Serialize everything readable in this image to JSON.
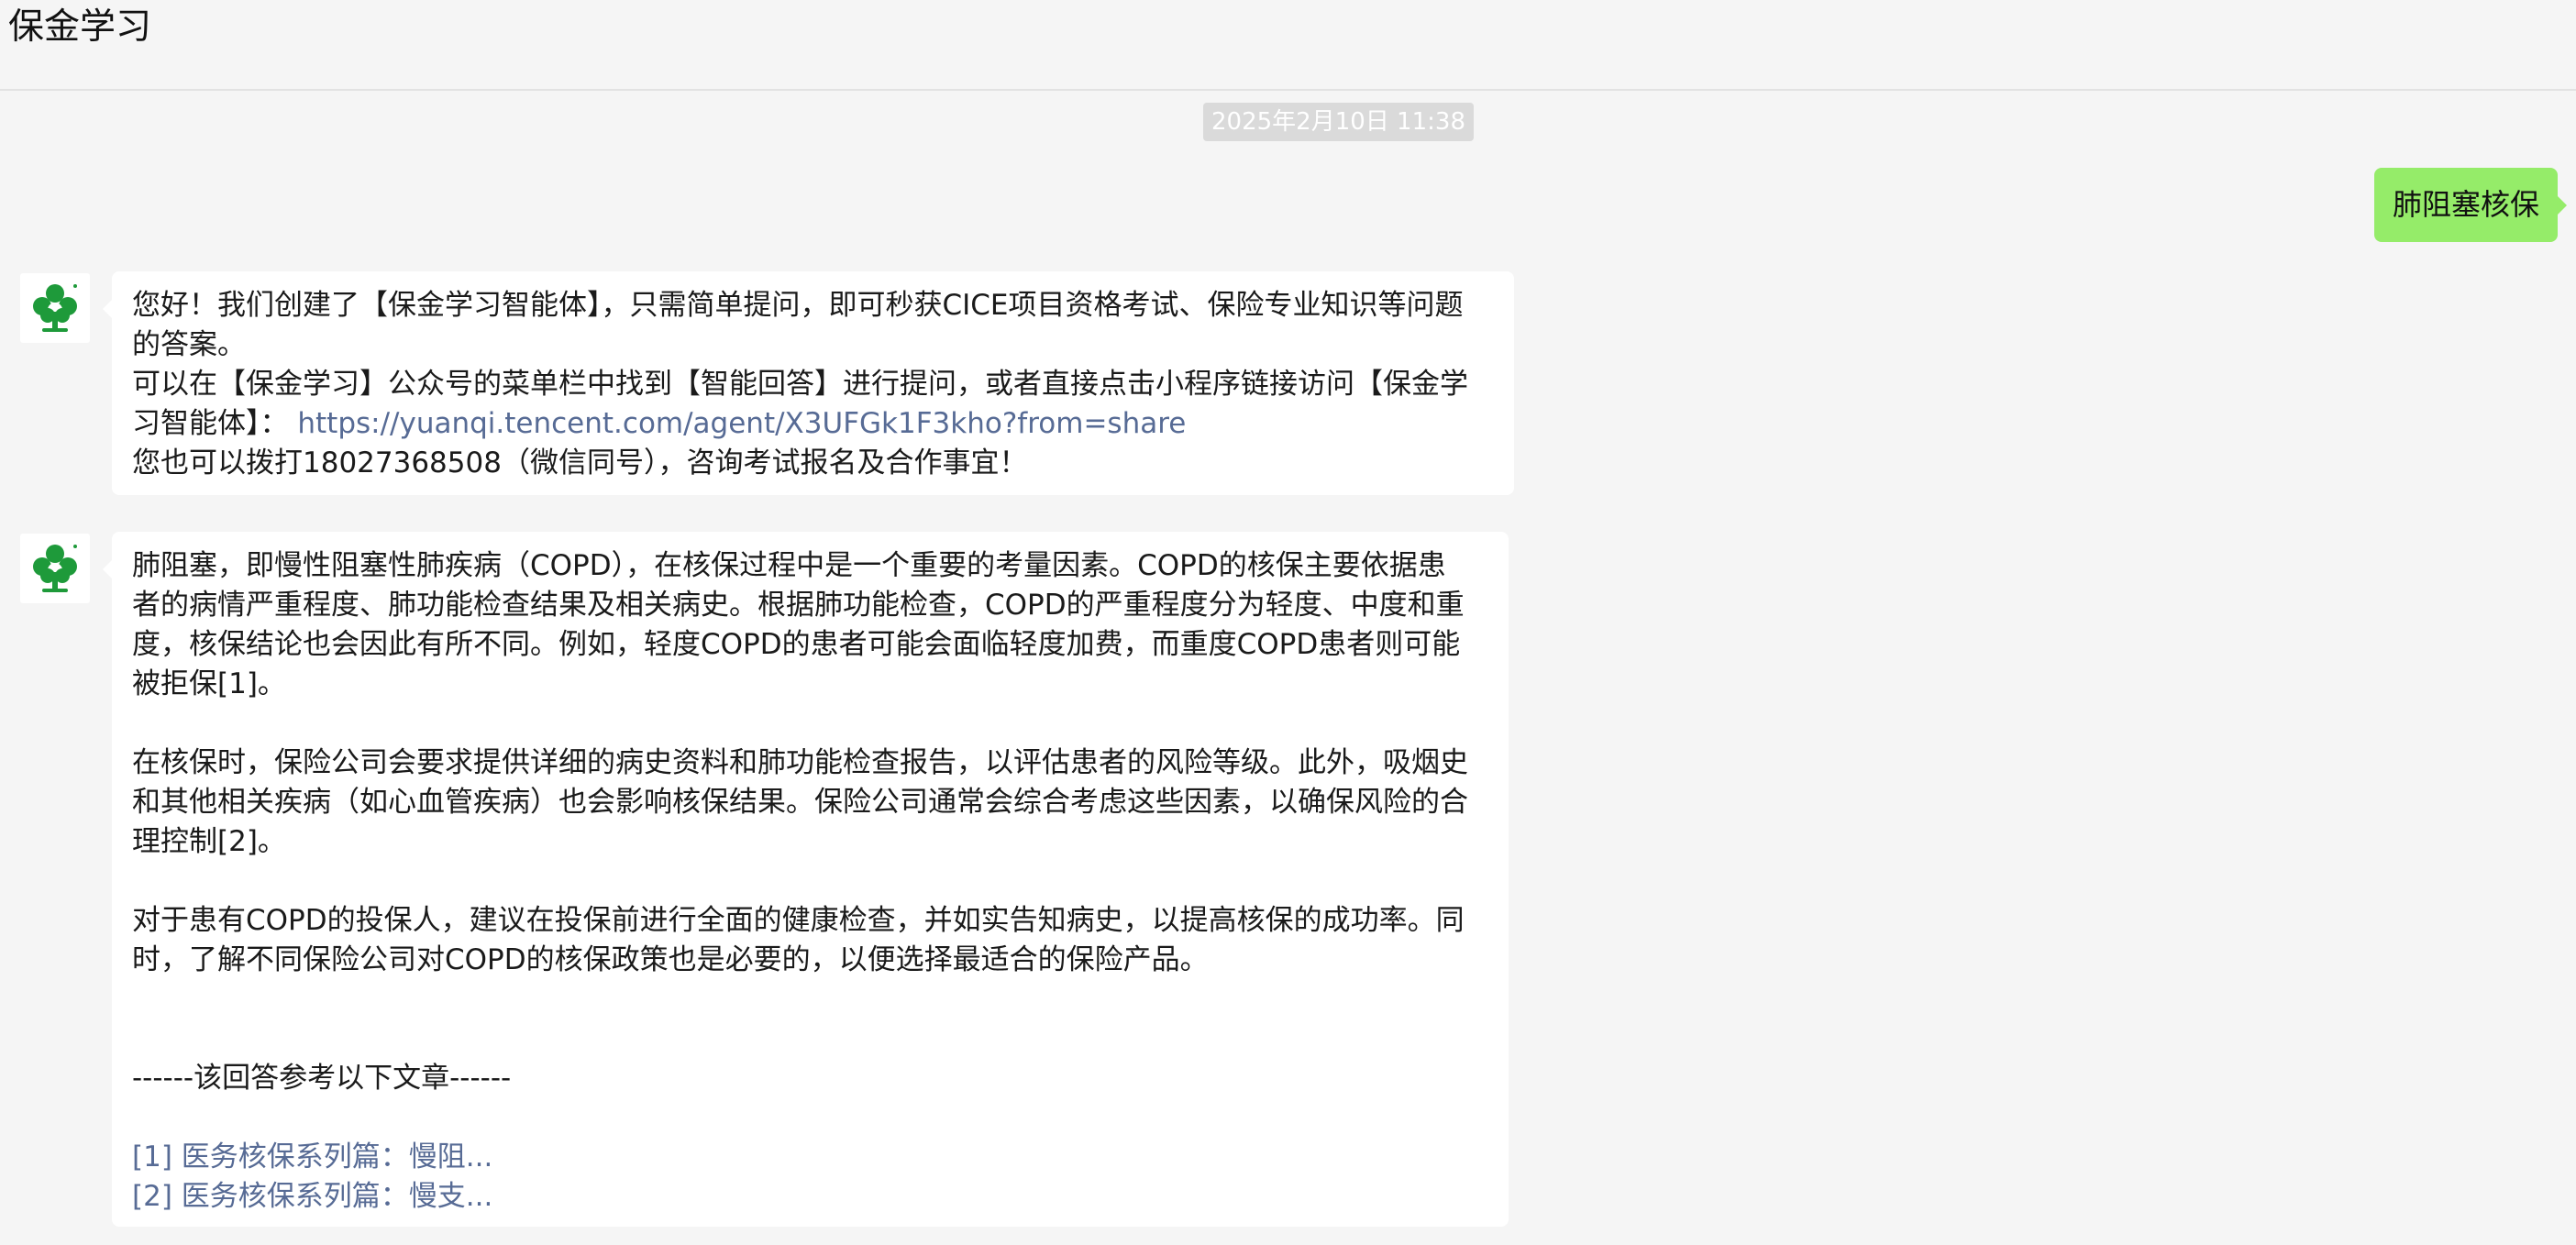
{
  "header": {
    "title": "保金学习"
  },
  "timestamp": "2025年2月10日 11:38",
  "outgoing": {
    "text": "肺阻塞核保"
  },
  "message1": {
    "line1": "您好！我们创建了【保金学习智能体】，只需简单提问，即可秒获CICE项目资格考试、保险专业知识等问题",
    "line2": "的答案。",
    "line3": "可以在【保金学习】公众号的菜单栏中找到【智能回答】进行提问，或者直接点击小程序链接访问【保金学",
    "line4_prefix": "习智能体】：",
    "link_url": "https://yuanqi.tencent.com/agent/X3UFGk1F3kho?from=share",
    "line5": "您也可以拨打18027368508（微信同号），咨询考试报名及合作事宜！"
  },
  "message2": {
    "p1": [
      "肺阻塞，即慢性阻塞性肺疾病（COPD），在核保过程中是一个重要的考量因素。COPD的核保主要依据患",
      "者的病情严重程度、肺功能检查结果及相关病史。根据肺功能检查，COPD的严重程度分为轻度、中度和重",
      "度，核保结论也会因此有所不同。例如，轻度COPD的患者可能会面临轻度加费，而重度COPD患者则可能",
      "被拒保[1]。"
    ],
    "p2": [
      "在核保时，保险公司会要求提供详细的病史资料和肺功能检查报告，以评估患者的风险等级。此外，吸烟史",
      "和其他相关疾病（如心血管疾病）也会影响核保结果。保险公司通常会综合考虑这些因素，以确保风险的合",
      "理控制[2]。"
    ],
    "p3": [
      "对于患有COPD的投保人，建议在投保前进行全面的健康检查，并如实告知病史，以提高核保的成功率。同",
      "时，了解不同保险公司对COPD的核保政策也是必要的，以便选择最适合的保险产品。"
    ],
    "ref_header": "------该回答参考以下文章------",
    "refs": [
      "[1] 医务核保系列篇：慢阻...",
      "[2] 医务核保系列篇：慢支..."
    ]
  },
  "colors": {
    "background": "#f5f5f5",
    "outgoing_bubble": "#95ec69",
    "incoming_bubble": "#ffffff",
    "link": "#576b95",
    "avatar_green": "#1e9a3a"
  },
  "icons": {
    "avatar": "green-tree-logo-icon"
  }
}
